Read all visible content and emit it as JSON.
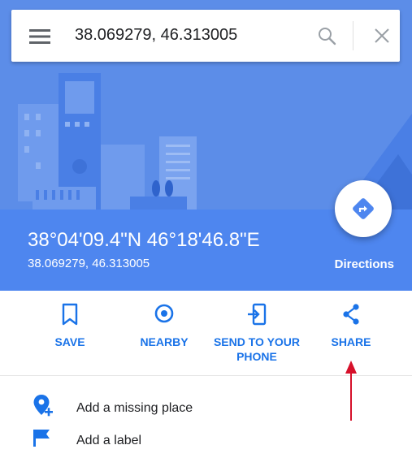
{
  "search": {
    "query": "38.069279, 46.313005",
    "icons": {
      "menu": "menu-icon",
      "search": "search-icon",
      "close": "close-icon"
    }
  },
  "place": {
    "coords_dms": "38°04'09.4\"N 46°18'46.8\"E",
    "coords_decimal": "38.069279, 46.313005",
    "directions_label": "Directions"
  },
  "actions": [
    {
      "label": "SAVE",
      "icon": "bookmark-icon"
    },
    {
      "label": "NEARBY",
      "icon": "nearby-pin-icon"
    },
    {
      "label": "SEND TO YOUR\nPHONE",
      "icon": "send-to-phone-icon"
    },
    {
      "label": "SHARE",
      "icon": "share-icon"
    }
  ],
  "list": [
    {
      "label": "Add a missing place",
      "icon": "add-place-pin-icon"
    },
    {
      "label": "Add a label",
      "icon": "label-flag-icon"
    }
  ],
  "colors": {
    "header_bg": "#5c8de8",
    "info_band": "#4e86ef",
    "accent": "#1a73e8",
    "annotation_arrow": "#d6102a"
  }
}
